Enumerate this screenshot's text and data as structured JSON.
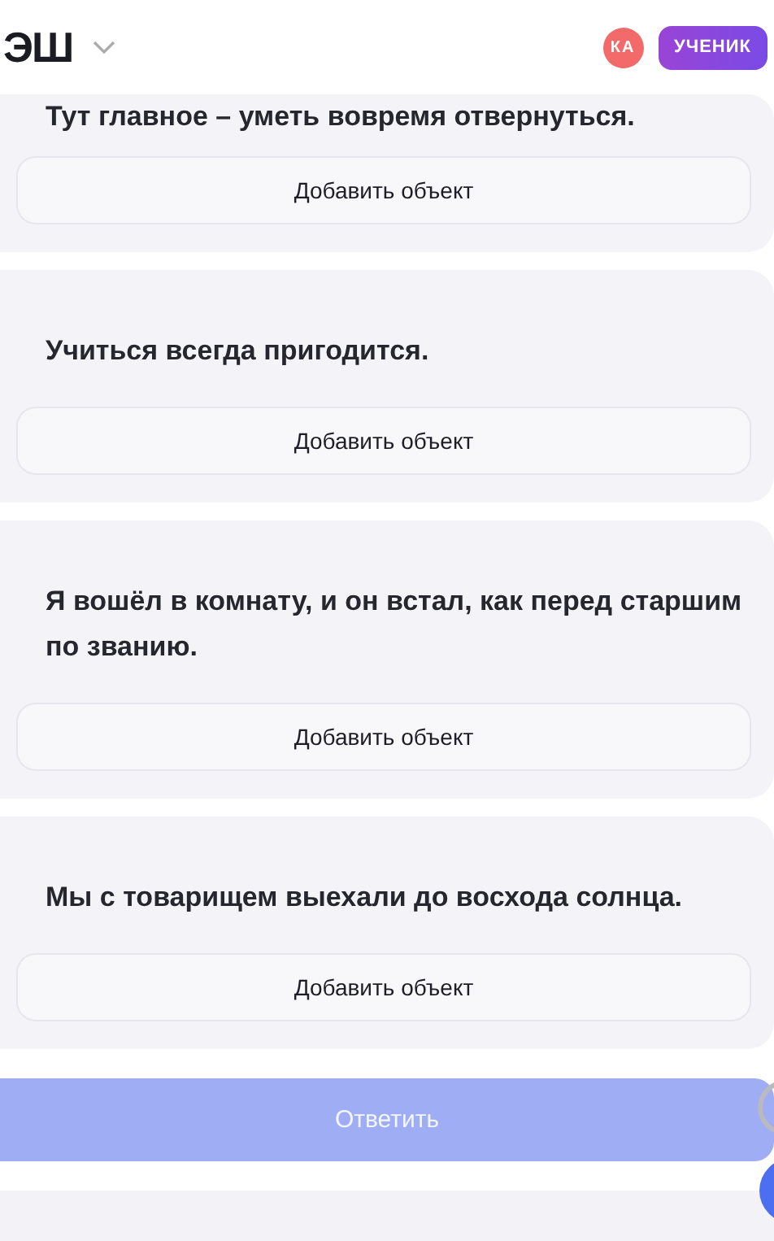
{
  "header": {
    "logo": "ЭШ",
    "avatar": "КА",
    "role_badge": "УЧЕНИК"
  },
  "tasks": [
    {
      "sentence": "Тут главное – уметь вовремя отвернуться.",
      "add_button": "Добавить объект"
    },
    {
      "sentence": "Учиться всегда пригодится.",
      "add_button": "Добавить объект"
    },
    {
      "sentence": "Я вошёл в комнату, и он встал, как перед старшим по званию.",
      "add_button": "Добавить объект"
    },
    {
      "sentence": "Мы с товарищем выехали до восхода солнца.",
      "add_button": "Добавить объект"
    }
  ],
  "submit": {
    "label": "Ответить",
    "disabled": true
  }
}
